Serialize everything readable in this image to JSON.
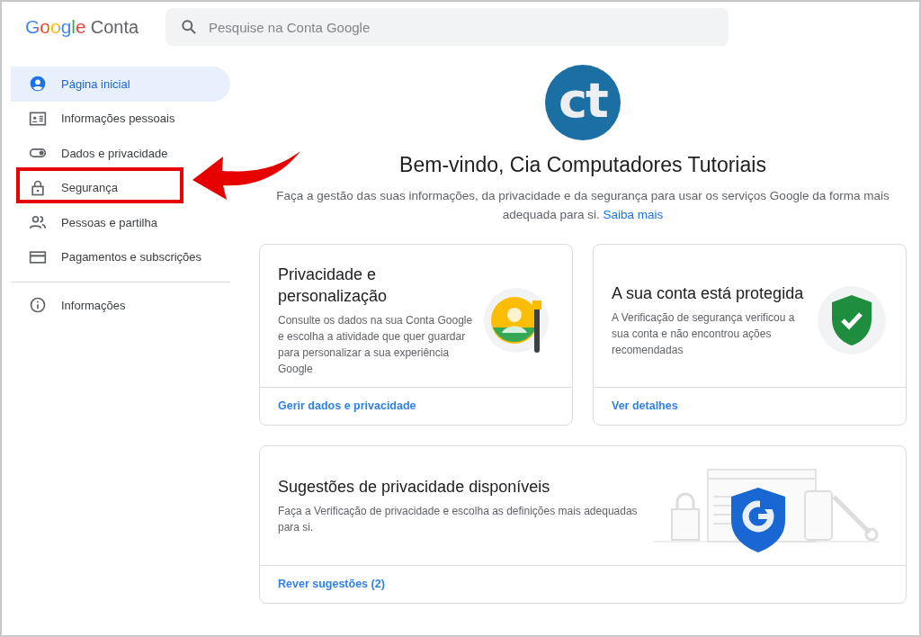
{
  "header": {
    "logo_word": "Google",
    "product": "Conta",
    "search": {
      "placeholder": "Pesquise na Conta Google"
    }
  },
  "sidebar": {
    "items": [
      {
        "label": "Página inicial",
        "kind": "account",
        "selected": true
      },
      {
        "label": "Informações pessoais",
        "kind": "idcard",
        "selected": false
      },
      {
        "label": "Dados e privacidade",
        "kind": "toggle",
        "selected": false
      },
      {
        "label": "Segurança",
        "kind": "lock",
        "selected": false,
        "highlighted": true
      },
      {
        "label": "Pessoas e partilha",
        "kind": "people",
        "selected": false
      },
      {
        "label": "Pagamentos e subscrições",
        "kind": "card",
        "selected": false
      }
    ],
    "footer_items": [
      {
        "label": "Informações",
        "kind": "info",
        "selected": false
      }
    ]
  },
  "welcome": {
    "avatar_text": "ct",
    "title": "Bem-vindo, Cia Computadores Tutoriais",
    "subtitle": "Faça a gestão das suas informações, da privacidade e da segurança para usar os serviços Google da forma mais adequada para si.",
    "link": "Saiba mais"
  },
  "cards": [
    {
      "kind": "privacy",
      "title": "Privacidade e personalização",
      "text": "Consulte os dados na sua Conta Google e escolha a atividade que quer guardar para personalizar a sua experiência Google",
      "action": "Gerir dados e privacidade"
    },
    {
      "kind": "security",
      "title": "A sua conta está protegida",
      "text": "A Verificação de segurança verificou a sua conta e não encontrou ações recomendadas",
      "action": "Ver detalhes"
    },
    {
      "kind": "suggestions",
      "title": "Sugestões de privacidade disponíveis",
      "text": "Faça a Verificação de privacidade e escolha as definições mais adequadas para si.",
      "action": "Rever sugestões (2)"
    }
  ]
}
